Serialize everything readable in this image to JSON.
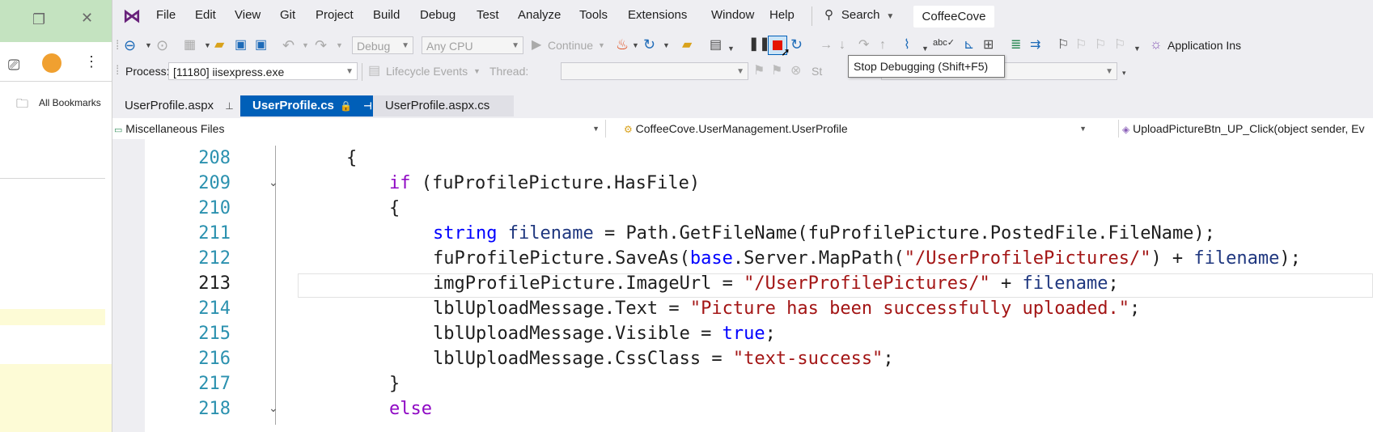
{
  "menubar": {
    "items": [
      "File",
      "Edit",
      "View",
      "Git",
      "Project",
      "Build",
      "Debug",
      "Test",
      "Analyze",
      "Tools",
      "Extensions",
      "Window",
      "Help"
    ],
    "search_label": "Search",
    "solution_name": "CoffeeCove"
  },
  "browser": {
    "bookmarks_label": "All Bookmarks"
  },
  "toolbar": {
    "config_value": "Debug",
    "platform_value": "Any CPU",
    "continue_label": "Continue",
    "application_insights_label": "Application Ins",
    "process_label": "Process:",
    "process_value": "[11180] iisexpress.exe",
    "lifecycle_label": "Lifecycle Events",
    "thread_label": "Thread:",
    "stack_label": "St"
  },
  "tooltip": {
    "text": "Stop Debugging (Shift+F5)"
  },
  "tabs": [
    {
      "label": "UserProfile.aspx"
    },
    {
      "label": "UserProfile.cs"
    },
    {
      "label": "UserProfile.aspx.cs"
    }
  ],
  "navbar": {
    "project": "Miscellaneous Files",
    "type": "CoffeeCove.UserManagement.UserProfile",
    "member": "UploadPictureBtn_UP_Click(object sender, Ev"
  },
  "editor": {
    "current_line": "213",
    "lines": [
      {
        "num": "208",
        "tokens": [
          {
            "t": "{",
            "c": "plain"
          }
        ]
      },
      {
        "num": "209",
        "tokens": [
          {
            "t": "if",
            "c": "ctrl"
          },
          {
            "t": " (",
            "c": "plain"
          },
          {
            "t": "fuProfilePicture",
            "c": "plain"
          },
          {
            "t": ".HasFile)",
            "c": "plain"
          }
        ]
      },
      {
        "num": "210",
        "tokens": [
          {
            "t": "{",
            "c": "plain"
          }
        ]
      },
      {
        "num": "211",
        "tokens": [
          {
            "t": "string",
            "c": "kw"
          },
          {
            "t": " ",
            "c": "plain"
          },
          {
            "t": "filename",
            "c": "id"
          },
          {
            "t": " = Path.GetFileName(fuProfilePicture.PostedFile.FileName);",
            "c": "plain"
          }
        ]
      },
      {
        "num": "212",
        "tokens": [
          {
            "t": "fuProfilePicture.SaveAs(",
            "c": "plain"
          },
          {
            "t": "base",
            "c": "kw"
          },
          {
            "t": ".Server.MapPath(",
            "c": "plain"
          },
          {
            "t": "\"/UserProfilePictures/\"",
            "c": "str"
          },
          {
            "t": ") + ",
            "c": "plain"
          },
          {
            "t": "filename",
            "c": "id"
          },
          {
            "t": ");",
            "c": "plain"
          }
        ]
      },
      {
        "num": "213",
        "tokens": [
          {
            "t": "imgProfilePicture.ImageUrl = ",
            "c": "plain"
          },
          {
            "t": "\"/UserProfilePictures/\"",
            "c": "str"
          },
          {
            "t": " + ",
            "c": "plain"
          },
          {
            "t": "filename",
            "c": "id"
          },
          {
            "t": ";",
            "c": "plain"
          }
        ]
      },
      {
        "num": "214",
        "tokens": [
          {
            "t": "lblUploadMessage.Text = ",
            "c": "plain"
          },
          {
            "t": "\"Picture has been successfully uploaded.\"",
            "c": "str"
          },
          {
            "t": ";",
            "c": "plain"
          }
        ]
      },
      {
        "num": "215",
        "tokens": [
          {
            "t": "lblUploadMessage.Visible = ",
            "c": "plain"
          },
          {
            "t": "true",
            "c": "kw"
          },
          {
            "t": ";",
            "c": "plain"
          }
        ]
      },
      {
        "num": "216",
        "tokens": [
          {
            "t": "lblUploadMessage.CssClass = ",
            "c": "plain"
          },
          {
            "t": "\"text-success\"",
            "c": "str"
          },
          {
            "t": ";",
            "c": "plain"
          }
        ]
      },
      {
        "num": "217",
        "tokens": [
          {
            "t": "}",
            "c": "plain"
          }
        ]
      },
      {
        "num": "218",
        "tokens": [
          {
            "t": "else",
            "c": "ctrl"
          }
        ]
      }
    ]
  },
  "colors": {
    "accent": "#005fb8",
    "stop": "#e51400",
    "keyword": "#0000ff",
    "control": "#8f08c4",
    "string": "#a31515",
    "line_number": "#2b91af"
  }
}
